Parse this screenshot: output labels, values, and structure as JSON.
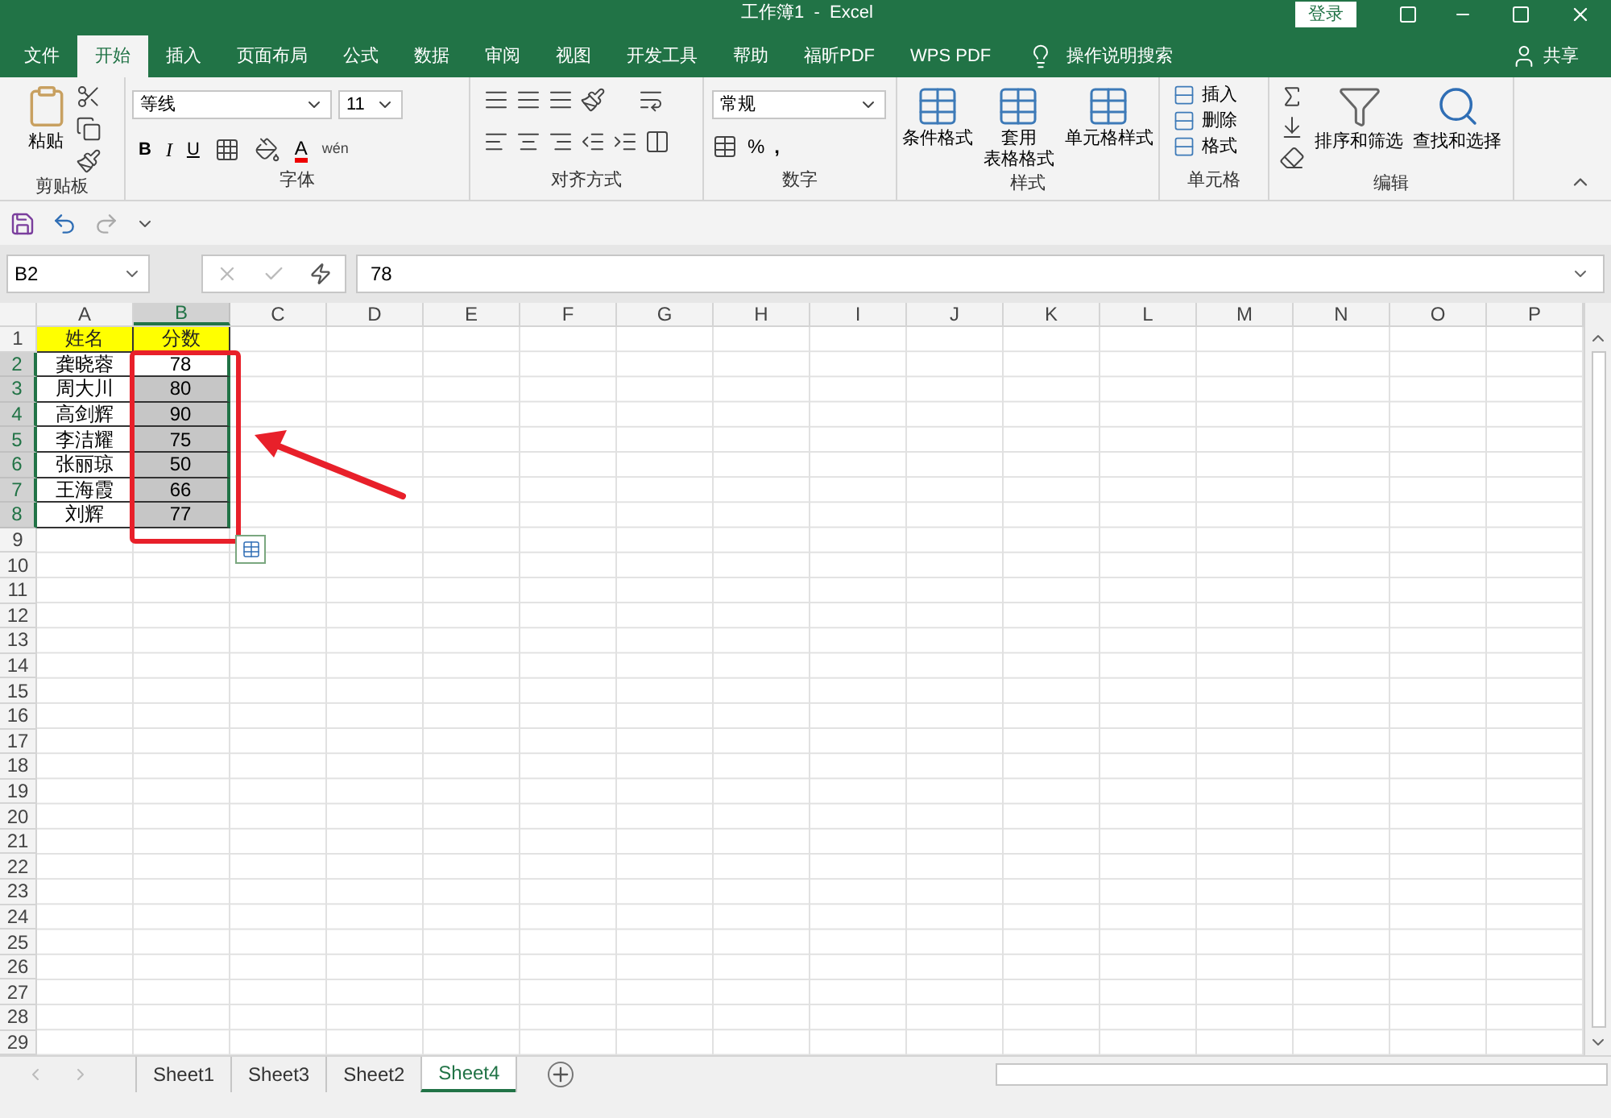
{
  "window": {
    "title": "工作簿1  -  Excel",
    "login_button": "登录"
  },
  "tabs": [
    {
      "label": "文件",
      "selected": false
    },
    {
      "label": "开始",
      "selected": true
    },
    {
      "label": "插入",
      "selected": false
    },
    {
      "label": "页面布局",
      "selected": false
    },
    {
      "label": "公式",
      "selected": false
    },
    {
      "label": "数据",
      "selected": false
    },
    {
      "label": "审阅",
      "selected": false
    },
    {
      "label": "视图",
      "selected": false
    },
    {
      "label": "开发工具",
      "selected": false
    },
    {
      "label": "帮助",
      "selected": false
    },
    {
      "label": "福昕PDF",
      "selected": false
    },
    {
      "label": "WPS PDF",
      "selected": false
    }
  ],
  "tell_me": "操作说明搜索",
  "share": "共享",
  "ribbon": {
    "clipboard": {
      "paste": "粘贴",
      "label": "剪贴板"
    },
    "font": {
      "name": "等线",
      "size": "11",
      "bold": "B",
      "italic": "I",
      "underline": "U",
      "font_color": "A",
      "phonetic": "wén",
      "label": "字体"
    },
    "alignment": {
      "label": "对齐方式"
    },
    "number": {
      "format": "常规",
      "percent": "%",
      "comma": ",",
      "label": "数字"
    },
    "styles": {
      "buttons": [
        {
          "lines": [
            "条件格式"
          ]
        },
        {
          "lines": [
            "套用",
            "表格格式"
          ]
        },
        {
          "lines": [
            "单元格样式"
          ]
        }
      ],
      "label": "样式"
    },
    "cells": {
      "buttons": [
        "插入",
        "删除",
        "格式"
      ],
      "label": "单元格"
    },
    "editing": {
      "buttons": [
        "排序和筛选",
        "查找和选择"
      ],
      "label": "编辑"
    }
  },
  "formula_bar": {
    "name_box": "B2",
    "value": "78"
  },
  "columns": [
    {
      "label": "A",
      "selected": false
    },
    {
      "label": "B",
      "selected": true
    },
    {
      "label": "C",
      "selected": false
    },
    {
      "label": "D",
      "selected": false
    },
    {
      "label": "E",
      "selected": false
    },
    {
      "label": "F",
      "selected": false
    },
    {
      "label": "G",
      "selected": false
    },
    {
      "label": "H",
      "selected": false
    },
    {
      "label": "I",
      "selected": false
    },
    {
      "label": "J",
      "selected": false
    },
    {
      "label": "K",
      "selected": false
    },
    {
      "label": "L",
      "selected": false
    },
    {
      "label": "M",
      "selected": false
    },
    {
      "label": "N",
      "selected": false
    },
    {
      "label": "O",
      "selected": false
    },
    {
      "label": "P",
      "selected": false
    }
  ],
  "rows": [
    {
      "number": "1",
      "selected": false,
      "cells": [
        {
          "text": "姓名",
          "kind": "header"
        },
        {
          "text": "分数",
          "kind": "header"
        }
      ]
    },
    {
      "number": "2",
      "selected": true,
      "cells": [
        {
          "text": "龚晓蓉",
          "kind": "data"
        },
        {
          "text": "78",
          "kind": "data",
          "selected": true,
          "active": true
        }
      ]
    },
    {
      "number": "3",
      "selected": true,
      "cells": [
        {
          "text": "周大川",
          "kind": "data"
        },
        {
          "text": "80",
          "kind": "data",
          "selected": true,
          "active": false
        }
      ]
    },
    {
      "number": "4",
      "selected": true,
      "cells": [
        {
          "text": "高剑辉",
          "kind": "data"
        },
        {
          "text": "90",
          "kind": "data",
          "selected": true,
          "active": false
        }
      ]
    },
    {
      "number": "5",
      "selected": true,
      "cells": [
        {
          "text": "李洁耀",
          "kind": "data"
        },
        {
          "text": "75",
          "kind": "data",
          "selected": true,
          "active": false
        }
      ]
    },
    {
      "number": "6",
      "selected": true,
      "cells": [
        {
          "text": "张丽琼",
          "kind": "data"
        },
        {
          "text": "50",
          "kind": "data",
          "selected": true,
          "active": false
        }
      ]
    },
    {
      "number": "7",
      "selected": true,
      "cells": [
        {
          "text": "王海霞",
          "kind": "data"
        },
        {
          "text": "66",
          "kind": "data",
          "selected": true,
          "active": false
        }
      ]
    },
    {
      "number": "8",
      "selected": true,
      "cells": [
        {
          "text": "刘辉",
          "kind": "data"
        },
        {
          "text": "77",
          "kind": "data",
          "selected": true,
          "active": false
        }
      ]
    },
    {
      "number": "9",
      "selected": false
    },
    {
      "number": "10",
      "selected": false
    },
    {
      "number": "11",
      "selected": false
    },
    {
      "number": "12",
      "selected": false
    },
    {
      "number": "13",
      "selected": false
    },
    {
      "number": "14",
      "selected": false
    },
    {
      "number": "15",
      "selected": false
    },
    {
      "number": "16",
      "selected": false
    },
    {
      "number": "17",
      "selected": false
    },
    {
      "number": "18",
      "selected": false
    },
    {
      "number": "19",
      "selected": false
    },
    {
      "number": "20",
      "selected": false
    },
    {
      "number": "21",
      "selected": false
    },
    {
      "number": "22",
      "selected": false
    },
    {
      "number": "23",
      "selected": false
    },
    {
      "number": "24",
      "selected": false
    },
    {
      "number": "25",
      "selected": false
    },
    {
      "number": "26",
      "selected": false
    },
    {
      "number": "27",
      "selected": false
    },
    {
      "number": "28",
      "selected": false
    },
    {
      "number": "29",
      "selected": false
    }
  ],
  "sheets": [
    {
      "label": "Sheet1",
      "selected": false
    },
    {
      "label": "Sheet3",
      "selected": false
    },
    {
      "label": "Sheet2",
      "selected": false
    },
    {
      "label": "Sheet4",
      "selected": true
    }
  ]
}
